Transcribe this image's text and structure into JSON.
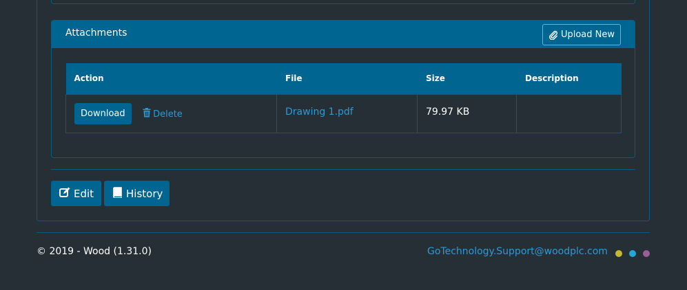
{
  "attachments": {
    "title": "Attachments",
    "upload_label": "Upload New",
    "table": {
      "headers": [
        "Action",
        "File",
        "Size",
        "Description"
      ],
      "rows": [
        {
          "download_label": "Download",
          "delete_label": "Delete",
          "file": "Drawing 1.pdf",
          "size": "79.97 KB",
          "description": ""
        }
      ]
    }
  },
  "actions": {
    "edit_label": "Edit",
    "history_label": "History"
  },
  "footer": {
    "copyright": "© 2019 - Wood (1.31.0)",
    "support_email": "GoTechnology.Support@woodplc.com",
    "theme_dots": [
      "#c5b834",
      "#27a7d8",
      "#9c5e9a"
    ]
  },
  "colors": {
    "background": "#252f35",
    "primary": "#006590",
    "border": "#0d5b7d",
    "link": "#2c9ad6"
  }
}
